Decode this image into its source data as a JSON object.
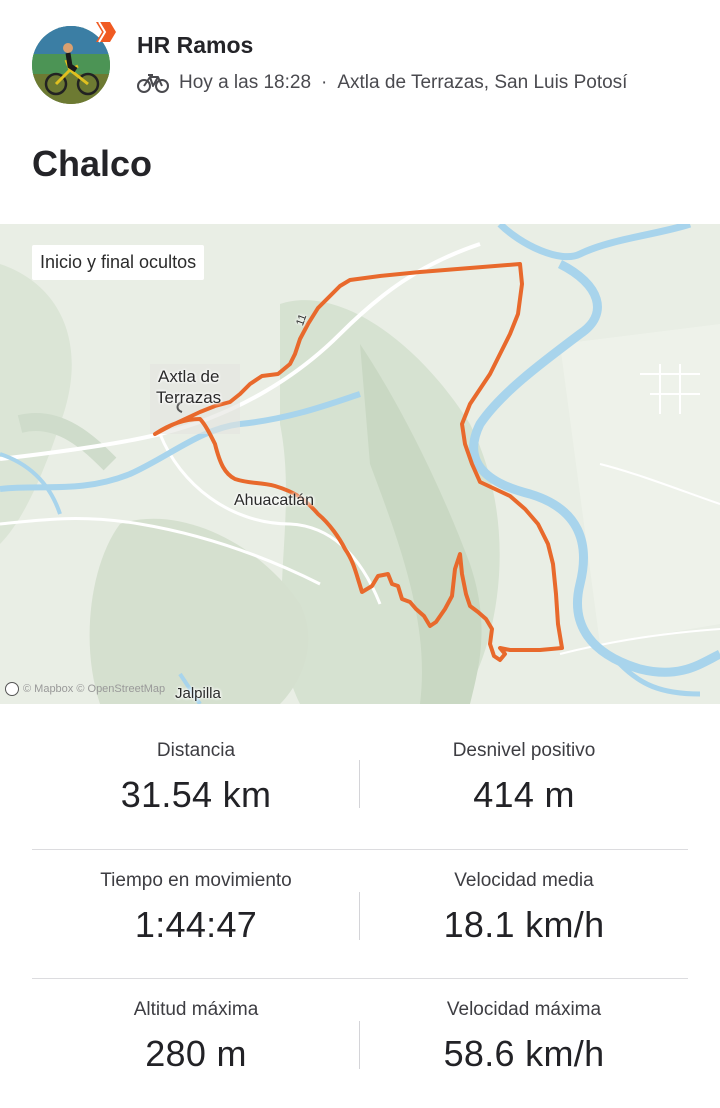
{
  "athlete": {
    "name": "HR Ramos",
    "avatar_icon": "cyclist-avatar",
    "badge_icon": "strava-badge-icon",
    "activity_icon": "bike-icon",
    "timestamp": "Hoy a las 18:28",
    "separator": "·",
    "location": "Axtla de Terrazas, San Luis Potosí"
  },
  "activity": {
    "title": "Chalco"
  },
  "map": {
    "privacy_chip": "Inicio y final ocultos",
    "labels": {
      "town1_line1": "Axtla de",
      "town1_line2": "Terrazas",
      "town2": "Ahuacatlán",
      "town3": "Jalpilla",
      "road_number": "11"
    },
    "attribution": "© Mapbox © OpenStreetMap",
    "route_color": "#e8692c",
    "river_color": "#a8d4ec"
  },
  "stats": {
    "distance": {
      "label": "Distancia",
      "value": "31.54 km"
    },
    "elevation_gain": {
      "label": "Desnivel positivo",
      "value": "414 m"
    },
    "moving_time": {
      "label": "Tiempo en movimiento",
      "value": "1:44:47"
    },
    "avg_speed": {
      "label": "Velocidad media",
      "value": "18.1 km/h"
    },
    "max_elevation": {
      "label": "Altitud máxima",
      "value": "280 m"
    },
    "max_speed": {
      "label": "Velocidad máxima",
      "value": "58.6 km/h"
    }
  }
}
